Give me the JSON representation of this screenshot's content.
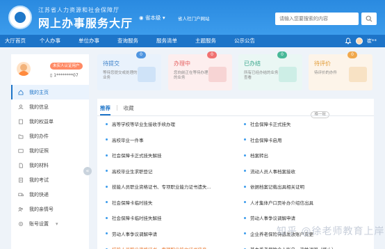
{
  "header": {
    "org_name": "江苏省人力资源和社会保障厅",
    "site_title": "网上办事服务大厅",
    "region": "省本级",
    "portal_link": "省人社门户网站",
    "search_placeholder": "请输入您要搜索的内容",
    "user_name": "崔**"
  },
  "nav": {
    "items": [
      "大厅首页",
      "个人办事",
      "单位办事",
      "查询服务",
      "服务清单",
      "主题服务",
      "公示公告"
    ]
  },
  "sidebar": {
    "badge": "未实人认证用户",
    "phone": "1********07",
    "menu": [
      {
        "label": "我的主页",
        "icon": "home-icon",
        "active": true
      },
      {
        "label": "我的信息",
        "icon": "user-icon",
        "active": false
      },
      {
        "label": "我的权益单",
        "icon": "document-icon",
        "active": false
      },
      {
        "label": "我的办件",
        "icon": "folder-icon",
        "active": false
      },
      {
        "label": "我的证照",
        "icon": "id-card-icon",
        "active": false
      },
      {
        "label": "我的材料",
        "icon": "file-icon",
        "active": false
      },
      {
        "label": "我的考试",
        "icon": "exam-icon",
        "active": false
      },
      {
        "label": "我的快递",
        "icon": "delivery-icon",
        "active": false
      },
      {
        "label": "我的亲情号",
        "icon": "family-icon",
        "active": false
      },
      {
        "label": "账号设置",
        "icon": "settings-icon",
        "active": false
      }
    ],
    "collapse_glyph": "«"
  },
  "cards": [
    {
      "title": "待提交",
      "desc": "等待您提交或处理的业务",
      "count": "0",
      "color": "#3a7fc8"
    },
    {
      "title": "办理中",
      "desc": "您向前正在等待办理的业务",
      "count": "0",
      "color": "#e55f5f"
    },
    {
      "title": "已办结",
      "desc": "所有已经办结的业务查看",
      "count": "0",
      "color": "#36a58a"
    },
    {
      "title": "待评价",
      "desc": "待评价的办件",
      "count": "0",
      "color": "#e19a34"
    }
  ],
  "services": {
    "tabs": [
      "推荐",
      "收藏"
    ],
    "batch_button": "换一批",
    "rows": [
      [
        "高等学校等毕业生接收手续办理",
        "社会保障卡正式挂失"
      ],
      [
        "高校毕业一件事",
        "社会保障卡启用"
      ],
      [
        "社会保障卡正式挂失解挂",
        "档案转出"
      ],
      [
        "高校毕业生求职登记",
        "流动人员人事档案接收"
      ],
      [
        "技能人员职业资格证书、专项职业能力证书遗失...",
        "依据档案记载出具相关证明"
      ],
      [
        "社会保障卡临时挂失",
        "人才集体户口页补办介绍信出具"
      ],
      [
        "社会保障卡临时挂失解挂",
        "劳动人事争议调解申请"
      ],
      [
        "劳动人事争议调解申请",
        "企业养老保险待遇发放账户变更"
      ],
      [
        "技能人员职业资格证书、专项职业能力证书信息...",
        "基本养老保险个人账户一次性退回（终止）"
      ]
    ],
    "orange_cells": [
      "8-0"
    ]
  },
  "watermark": "知乎 @徐老师教育上岸"
}
